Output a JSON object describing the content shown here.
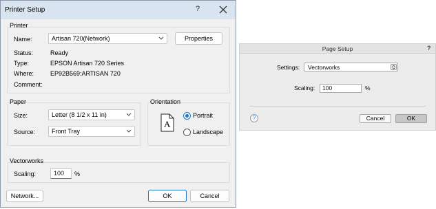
{
  "printer_setup": {
    "title": "Printer Setup",
    "help_glyph": "?",
    "printer_group": {
      "label": "Printer",
      "name_label": "Name:",
      "name_value": "Artisan 720(Network)",
      "properties_label": "Properties",
      "status_label": "Status:",
      "status_value": "Ready",
      "type_label": "Type:",
      "type_value": "EPSON Artisan 720 Series",
      "where_label": "Where:",
      "where_value": "EP92B569:ARTISAN 720",
      "comment_label": "Comment:"
    },
    "paper_group": {
      "label": "Paper",
      "size_label": "Size:",
      "size_value": "Letter (8 1/2 x 11 in)",
      "source_label": "Source:",
      "source_value": "Front Tray"
    },
    "orientation_group": {
      "label": "Orientation",
      "page_glyph": "A",
      "portrait_label": "Portrait",
      "landscape_label": "Landscape",
      "selected": "portrait"
    },
    "vectorworks_group": {
      "label": "Vectorworks",
      "scaling_label": "Scaling:",
      "scaling_value": "100",
      "percent": "%"
    },
    "network_label": "Network...",
    "ok_label": "OK",
    "cancel_label": "Cancel",
    "accent_color": "#1d6fc7"
  },
  "page_setup": {
    "title": "Page Setup",
    "help_glyph": "?",
    "settings_label": "Settings:",
    "settings_value": "Vectorworks",
    "scaling_label": "Scaling:",
    "scaling_value": "100",
    "percent": "%",
    "help_button_glyph": "?",
    "cancel_label": "Cancel",
    "ok_label": "OK"
  }
}
